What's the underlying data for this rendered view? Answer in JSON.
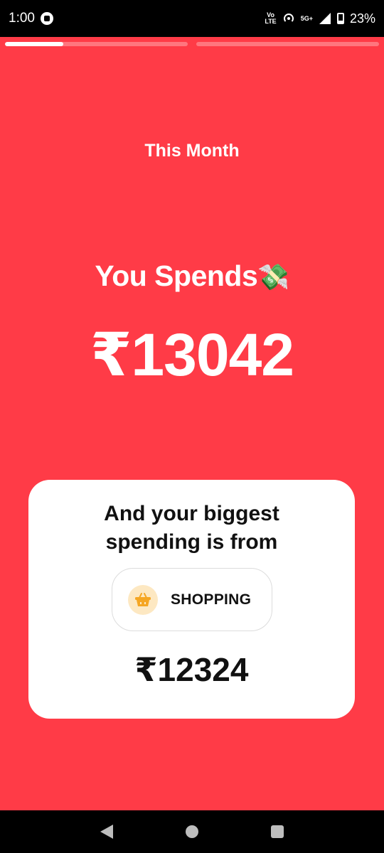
{
  "status_bar": {
    "time": "1:00",
    "volte_line1": "Vo",
    "volte_line2": "LTE",
    "network": "5G+",
    "battery": "23%",
    "icons": [
      "app-notification-icon",
      "hotspot-icon",
      "signal-icon",
      "battery-icon"
    ]
  },
  "progress": {
    "segments": [
      {
        "fill_percent": 32
      },
      {
        "fill_percent": 0
      }
    ]
  },
  "summary": {
    "period_label": "This Month",
    "title": "You Spends",
    "title_emoji": "💸",
    "total_amount": "₹13042"
  },
  "card": {
    "heading": "And your biggest spending is from",
    "category_label": "SHOPPING",
    "category_icon": "shopping-basket-icon",
    "category_amount": "₹12324"
  },
  "nav_bar": {
    "icons": [
      "back-icon",
      "home-icon",
      "recents-icon"
    ]
  },
  "colors": {
    "background": "#ff3b47",
    "card": "#ffffff",
    "chip_icon_bg": "#fde8c2",
    "basket": "#f5a623"
  }
}
